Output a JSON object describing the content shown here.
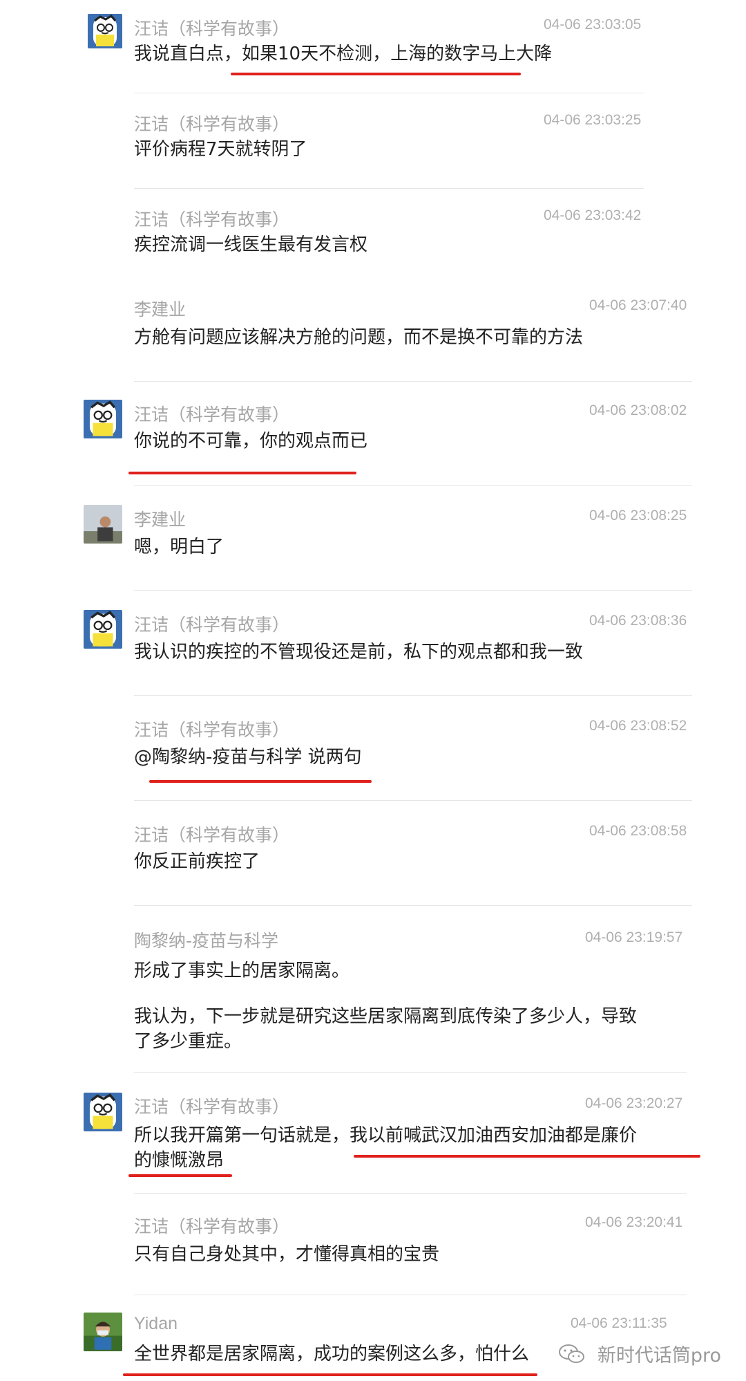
{
  "messages": [
    {
      "name": "汪诘（科学有故事）",
      "time": "04-06 23:03:05",
      "lines": [
        "我说直白点，如果10天不检测，上海的数字马上大降"
      ]
    },
    {
      "name": "汪诘（科学有故事）",
      "time": "04-06 23:03:25",
      "lines": [
        "评价病程7天就转阴了"
      ]
    },
    {
      "name": "汪诘（科学有故事）",
      "time": "04-06 23:03:42",
      "lines": [
        "疾控流调一线医生最有发言权"
      ]
    },
    {
      "name": "李建业",
      "time": "04-06 23:07:40",
      "lines": [
        "方舱有问题应该解决方舱的问题，而不是换不可靠的方法"
      ]
    },
    {
      "name": "汪诘（科学有故事）",
      "time": "04-06 23:08:02",
      "lines": [
        "你说的不可靠，你的观点而已"
      ]
    },
    {
      "name": "李建业",
      "time": "04-06 23:08:25",
      "lines": [
        "嗯，明白了"
      ]
    },
    {
      "name": "汪诘（科学有故事）",
      "time": "04-06 23:08:36",
      "lines": [
        "我认识的疾控的不管现役还是前，私下的观点都和我一致"
      ]
    },
    {
      "name": "汪诘（科学有故事）",
      "time": "04-06 23:08:52",
      "lines": [
        "@陶黎纳-疫苗与科学 说两句"
      ]
    },
    {
      "name": "汪诘（科学有故事）",
      "time": "04-06 23:08:58",
      "lines": [
        "你反正前疾控了"
      ]
    },
    {
      "name": "陶黎纳-疫苗与科学",
      "time": "04-06 23:19:57",
      "lines": [
        "形成了事实上的居家隔离。",
        "",
        "我认为，下一步就是研究这些居家隔离到底传染了多少人，导致",
        "了多少重症。"
      ]
    },
    {
      "name": "汪诘（科学有故事）",
      "time": "04-06 23:20:27",
      "lines": [
        "所以我开篇第一句话就是，我以前喊武汉加油西安加油都是廉价",
        "的慷慨激昂"
      ]
    },
    {
      "name": "汪诘（科学有故事）",
      "time": "04-06 23:20:41",
      "lines": [
        "只有自己身处其中，才懂得真相的宝贵"
      ]
    },
    {
      "name": "Yidan",
      "time": "04-06 23:11:35",
      "lines": [
        "全世界都是居家隔离，成功的案例这么多，怕什么"
      ]
    }
  ],
  "watermark": {
    "text": "新时代话筒pro",
    "icon": "wechat-icon"
  },
  "colors": {
    "underline": "#e0211c",
    "name": "#a6a6a6",
    "time": "#b0b0b0",
    "text": "#222222"
  }
}
